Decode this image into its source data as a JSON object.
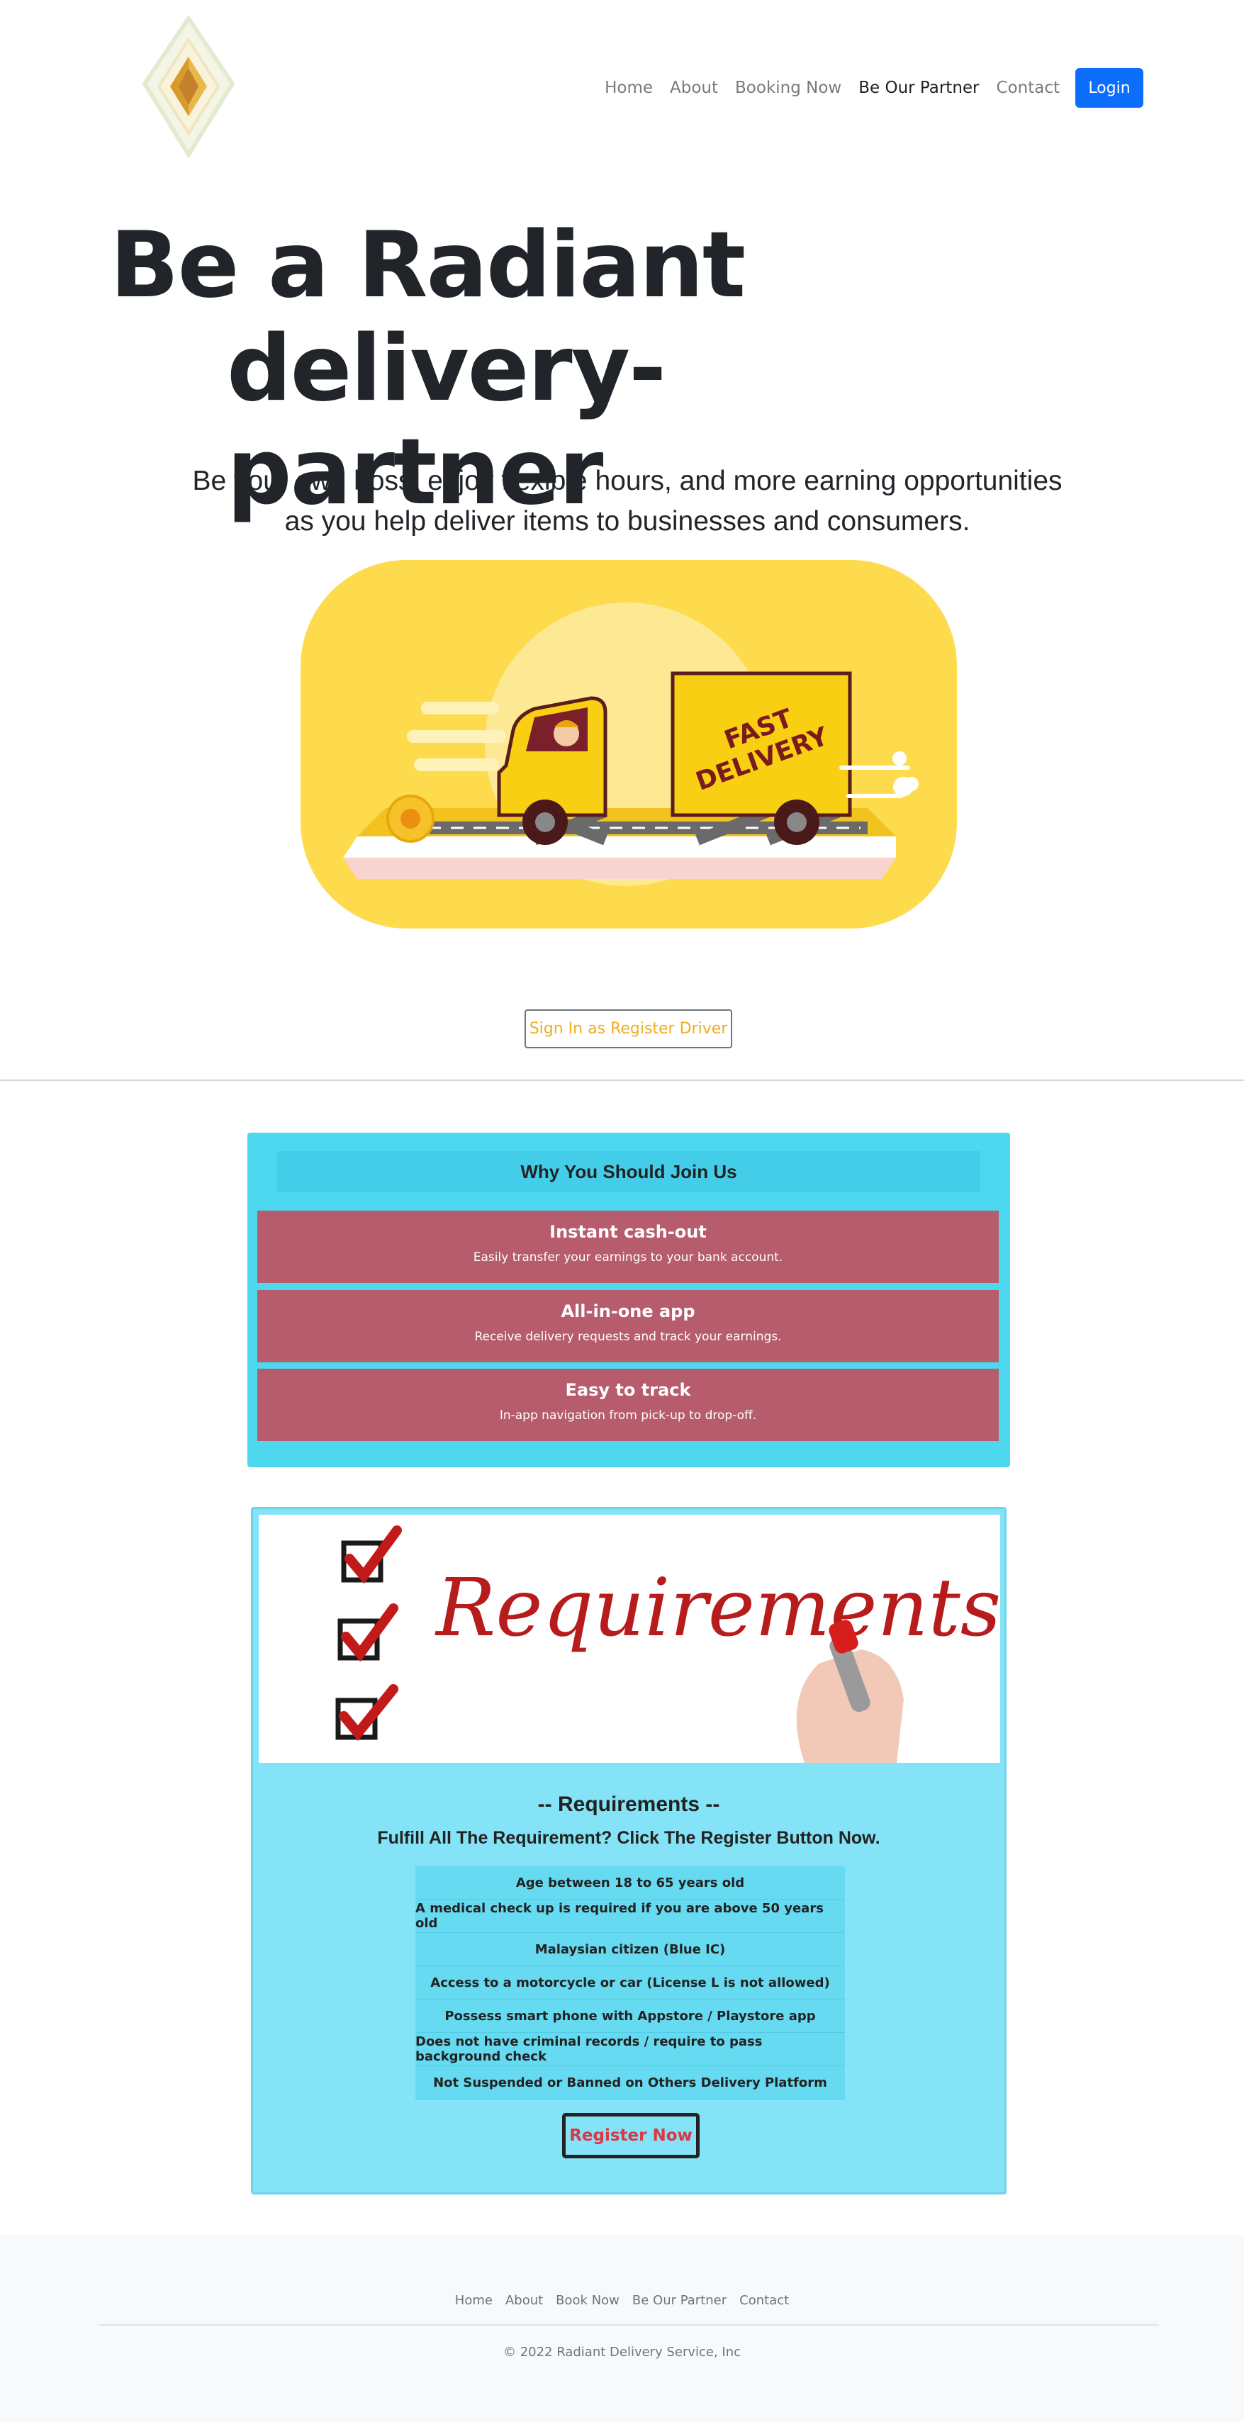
{
  "nav": {
    "items": [
      {
        "label": "Home",
        "active": false
      },
      {
        "label": "About",
        "active": false
      },
      {
        "label": "Booking Now",
        "active": false
      },
      {
        "label": "Be Our Partner",
        "active": true
      },
      {
        "label": "Contact",
        "active": false
      }
    ],
    "login_label": "Login"
  },
  "hero": {
    "title_line1": "Be a Radiant",
    "title_line2": "delivery-partner",
    "subtitle": "Be your own boss, enjoy flexible hours, and more earning opportunities as you help deliver items to businesses and consumers.",
    "truck_text": [
      "FAST",
      "DELIVERY"
    ],
    "driver_button": "Sign In as Register Driver"
  },
  "why": {
    "heading": "Why You Should Join Us",
    "benefits": [
      {
        "title": "Instant cash-out",
        "desc": "Easily transfer your earnings to your bank account."
      },
      {
        "title": "All-in-one app",
        "desc": "Receive delivery requests and track your earnings."
      },
      {
        "title": "Easy to track",
        "desc": "In-app navigation from pick-up to drop-off."
      }
    ]
  },
  "requirements": {
    "image_text": "Requirements",
    "title": "-- Requirements --",
    "subtitle": "Fulfill All The Requirement? Click The Register Button Now.",
    "items": [
      "Age between 18 to 65 years old",
      "A medical check up is required if you are above 50 years old",
      "Malaysian citizen (Blue IC)",
      "Access to a motorcycle or car (License L is not allowed)",
      "Possess smart phone with Appstore / Playstore app",
      "Does not have criminal records / require to pass background check",
      "Not Suspended or Banned on Others Delivery Platform"
    ],
    "register_label": "Register Now"
  },
  "footer": {
    "links": [
      "Home",
      "About",
      "Book Now",
      "Be Our Partner",
      "Contact"
    ],
    "copyright": "© 2022 Radiant Delivery Service, Inc"
  },
  "colors": {
    "primary": "#0d6efd",
    "why_bg": "#4dd8f0",
    "benefit_bg": "#b65c6c",
    "req_bg": "#84e3f6",
    "accent_yellow": "#f0ad21",
    "register_text": "#dc3545"
  }
}
